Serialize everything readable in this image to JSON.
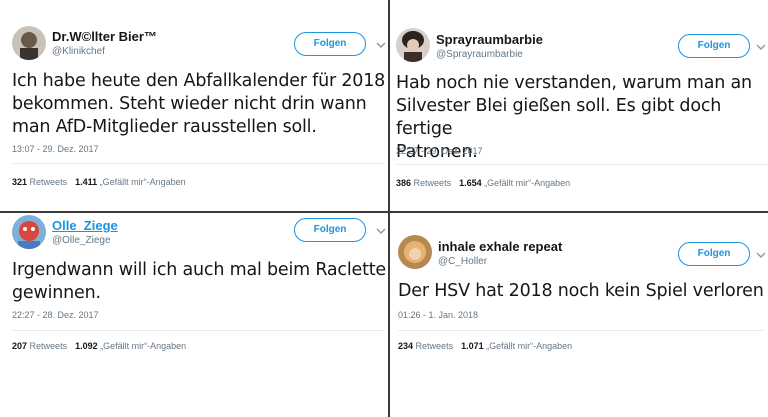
{
  "tweets": [
    {
      "name": "Dr.W©llter Bier™",
      "handle": "@Klinikchef",
      "follow": "Folgen",
      "lines": [
        "Ich habe heute den Abfallkalender für 2018",
        "bekommen. Steht wieder nicht drin wann",
        "man AfD-Mitglieder rausstellen soll."
      ],
      "timestamp": "13:07 - 29. Dez. 2017",
      "retweets": "321",
      "retweets_label": "Retweets",
      "likes": "1.411",
      "likes_label": "„Gefällt mir“-Angaben"
    },
    {
      "name": "Sprayraumbarbie",
      "handle": "@Sprayraumbarbie",
      "follow": "Folgen",
      "lines": [
        "Hab noch nie verstanden, warum man an",
        "Silvester Blei gießen soll. Es gibt doch fertige",
        "Patronen."
      ],
      "timestamp": "22:27 - 29. Dez. 2017",
      "retweets": "386",
      "retweets_label": "Retweets",
      "likes": "1.654",
      "likes_label": "„Gefällt mir“-Angaben"
    },
    {
      "name": "Olle_Ziege",
      "handle": "@Olle_Ziege",
      "follow": "Folgen",
      "lines": [
        "Irgendwann will ich auch mal beim Raclette",
        "gewinnen."
      ],
      "timestamp": "22:27 - 28. Dez. 2017",
      "retweets": "207",
      "retweets_label": "Retweets",
      "likes": "1.092",
      "likes_label": "„Gefällt mir“-Angaben"
    },
    {
      "name": "inhale exhale repeat",
      "handle": "@C_Holler",
      "follow": "Folgen",
      "lines": [
        "Der HSV hat 2018 noch kein Spiel verloren"
      ],
      "timestamp": "01:26 - 1. Jan. 2018",
      "retweets": "234",
      "retweets_label": "Retweets",
      "likes": "1.071",
      "likes_label": "„Gefällt mir“-Angaben"
    }
  ],
  "colors": {
    "accent": "#1b95e0",
    "text": "#14171a",
    "muted": "#657786",
    "divider": "#3a3a3a"
  }
}
